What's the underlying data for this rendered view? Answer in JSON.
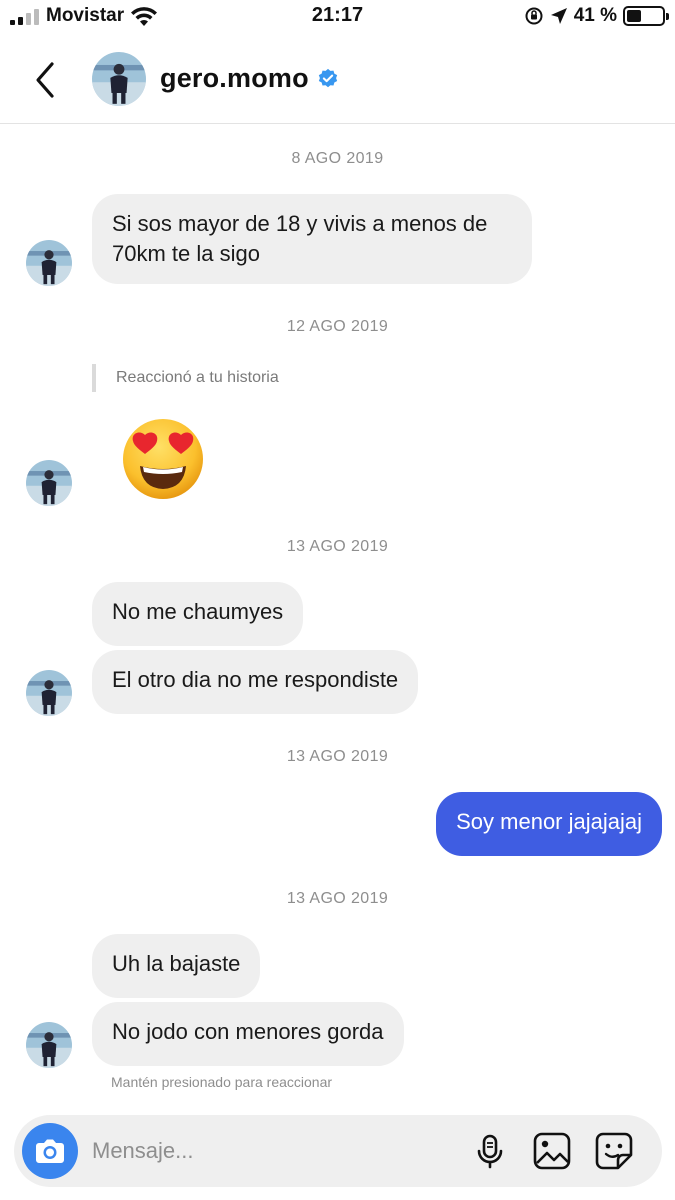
{
  "status_bar": {
    "carrier": "Movistar",
    "time": "21:17",
    "battery_text": "41 %",
    "battery_level": 0.41,
    "icons": [
      "signal-icon",
      "wifi-icon",
      "orientation-lock-icon",
      "location-icon",
      "battery-icon"
    ]
  },
  "header": {
    "back_icon": "chevron-left-icon",
    "username": "gero.momo",
    "verified_icon": "verified-badge-icon"
  },
  "conversation": {
    "dates": [
      "8 AGO 2019",
      "12 AGO 2019",
      "13 AGO 2019",
      "13 AGO 2019",
      "13 AGO 2019"
    ],
    "messages": [
      {
        "from": "them",
        "text_lines": [
          "Si sos mayor de 18 y vivis a menos de",
          "70km te la sigo"
        ]
      },
      {
        "from": "them",
        "type": "story-reaction",
        "label": "Reaccionó a tu historia",
        "emoji": "heart-eyes-emoji"
      },
      {
        "from": "them",
        "text": "No me chaumyes"
      },
      {
        "from": "them",
        "text": "El otro dia no me respondiste"
      },
      {
        "from": "me",
        "text": "Soy menor jajajajaj"
      },
      {
        "from": "them",
        "text": "Uh la bajaste"
      },
      {
        "from": "them",
        "text": "No jodo con menores gorda"
      }
    ],
    "hint": "Mantén presionado para reaccionar"
  },
  "composer": {
    "placeholder": "Mensaje...",
    "icons": [
      "camera-icon",
      "microphone-icon",
      "gallery-icon",
      "sticker-icon"
    ]
  },
  "colors": {
    "sent_bubble": "#3f5de2",
    "received_bubble": "#efefef",
    "verified": "#3897f0",
    "camera": "#3a85ee"
  }
}
